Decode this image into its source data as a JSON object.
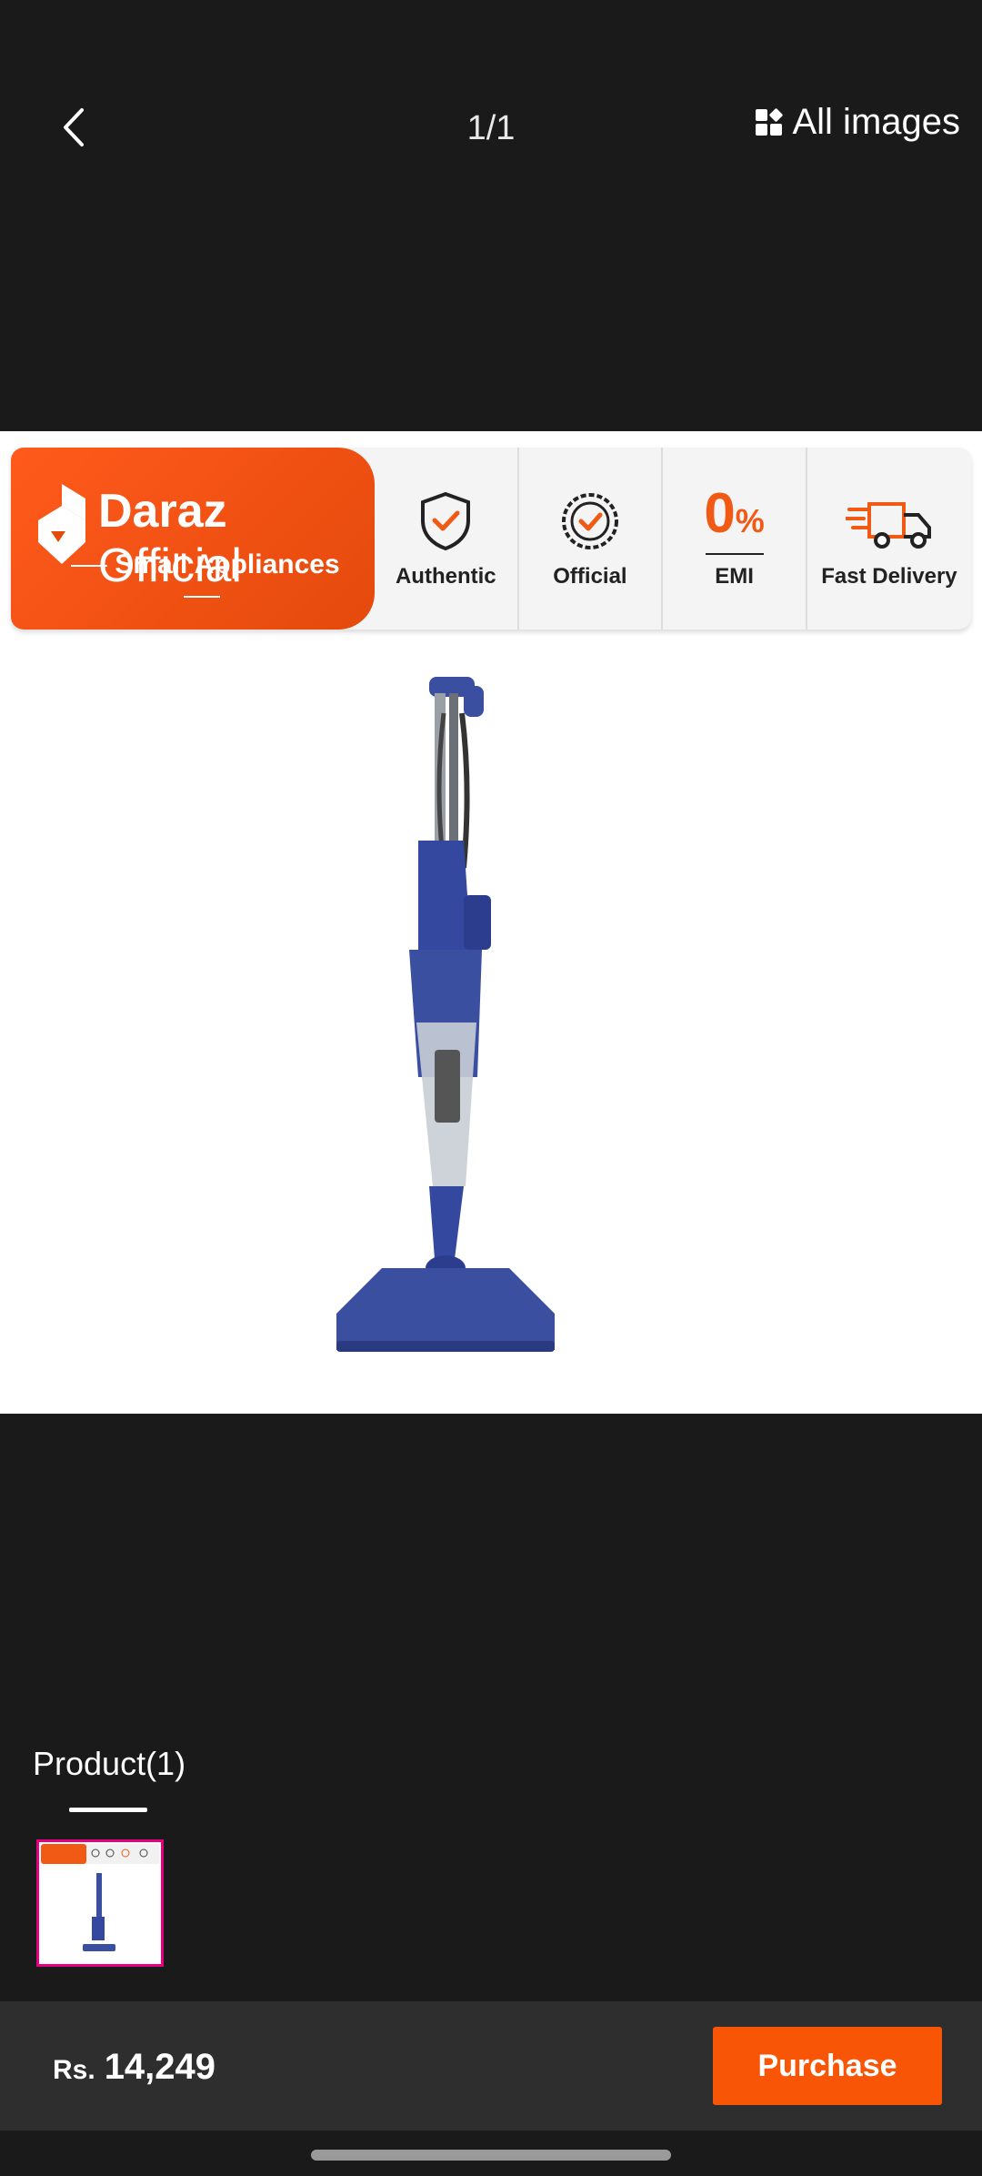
{
  "header": {
    "counter": "1/1",
    "all_images_label": "All images"
  },
  "banner": {
    "brand_name": "Daraz",
    "brand_official": "Official",
    "brand_subtitle": "Small Appliances",
    "badges": [
      {
        "label": "Authentic",
        "icon": "shield-check-icon"
      },
      {
        "label": "Official",
        "icon": "seal-check-icon"
      },
      {
        "label": "EMI",
        "value": "0",
        "unit": "%"
      },
      {
        "label": "Fast Delivery",
        "icon": "delivery-truck-icon"
      }
    ]
  },
  "product_tab": {
    "label": "Product(1)"
  },
  "bottom": {
    "currency": "Rs.",
    "price": "14,249",
    "purchase_label": "Purchase"
  },
  "colors": {
    "brand_orange": "#f85606",
    "thumb_border": "#e6007e",
    "background": "#1a1a1a",
    "bottom_bar": "#2e2e2e"
  }
}
